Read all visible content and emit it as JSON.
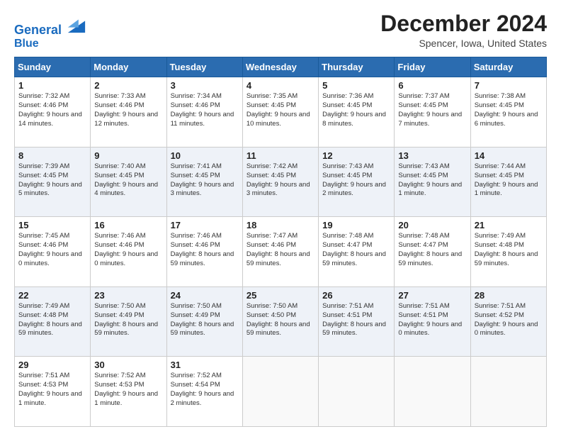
{
  "header": {
    "logo_line1": "General",
    "logo_line2": "Blue",
    "title": "December 2024",
    "subtitle": "Spencer, Iowa, United States"
  },
  "days_of_week": [
    "Sunday",
    "Monday",
    "Tuesday",
    "Wednesday",
    "Thursday",
    "Friday",
    "Saturday"
  ],
  "weeks": [
    [
      {
        "day": "1",
        "sunrise": "7:32 AM",
        "sunset": "4:46 PM",
        "daylight": "9 hours and 14 minutes."
      },
      {
        "day": "2",
        "sunrise": "7:33 AM",
        "sunset": "4:46 PM",
        "daylight": "9 hours and 12 minutes."
      },
      {
        "day": "3",
        "sunrise": "7:34 AM",
        "sunset": "4:46 PM",
        "daylight": "9 hours and 11 minutes."
      },
      {
        "day": "4",
        "sunrise": "7:35 AM",
        "sunset": "4:45 PM",
        "daylight": "9 hours and 10 minutes."
      },
      {
        "day": "5",
        "sunrise": "7:36 AM",
        "sunset": "4:45 PM",
        "daylight": "9 hours and 8 minutes."
      },
      {
        "day": "6",
        "sunrise": "7:37 AM",
        "sunset": "4:45 PM",
        "daylight": "9 hours and 7 minutes."
      },
      {
        "day": "7",
        "sunrise": "7:38 AM",
        "sunset": "4:45 PM",
        "daylight": "9 hours and 6 minutes."
      }
    ],
    [
      {
        "day": "8",
        "sunrise": "7:39 AM",
        "sunset": "4:45 PM",
        "daylight": "9 hours and 5 minutes."
      },
      {
        "day": "9",
        "sunrise": "7:40 AM",
        "sunset": "4:45 PM",
        "daylight": "9 hours and 4 minutes."
      },
      {
        "day": "10",
        "sunrise": "7:41 AM",
        "sunset": "4:45 PM",
        "daylight": "9 hours and 3 minutes."
      },
      {
        "day": "11",
        "sunrise": "7:42 AM",
        "sunset": "4:45 PM",
        "daylight": "9 hours and 3 minutes."
      },
      {
        "day": "12",
        "sunrise": "7:43 AM",
        "sunset": "4:45 PM",
        "daylight": "9 hours and 2 minutes."
      },
      {
        "day": "13",
        "sunrise": "7:43 AM",
        "sunset": "4:45 PM",
        "daylight": "9 hours and 1 minute."
      },
      {
        "day": "14",
        "sunrise": "7:44 AM",
        "sunset": "4:45 PM",
        "daylight": "9 hours and 1 minute."
      }
    ],
    [
      {
        "day": "15",
        "sunrise": "7:45 AM",
        "sunset": "4:46 PM",
        "daylight": "9 hours and 0 minutes."
      },
      {
        "day": "16",
        "sunrise": "7:46 AM",
        "sunset": "4:46 PM",
        "daylight": "9 hours and 0 minutes."
      },
      {
        "day": "17",
        "sunrise": "7:46 AM",
        "sunset": "4:46 PM",
        "daylight": "8 hours and 59 minutes."
      },
      {
        "day": "18",
        "sunrise": "7:47 AM",
        "sunset": "4:46 PM",
        "daylight": "8 hours and 59 minutes."
      },
      {
        "day": "19",
        "sunrise": "7:48 AM",
        "sunset": "4:47 PM",
        "daylight": "8 hours and 59 minutes."
      },
      {
        "day": "20",
        "sunrise": "7:48 AM",
        "sunset": "4:47 PM",
        "daylight": "8 hours and 59 minutes."
      },
      {
        "day": "21",
        "sunrise": "7:49 AM",
        "sunset": "4:48 PM",
        "daylight": "8 hours and 59 minutes."
      }
    ],
    [
      {
        "day": "22",
        "sunrise": "7:49 AM",
        "sunset": "4:48 PM",
        "daylight": "8 hours and 59 minutes."
      },
      {
        "day": "23",
        "sunrise": "7:50 AM",
        "sunset": "4:49 PM",
        "daylight": "8 hours and 59 minutes."
      },
      {
        "day": "24",
        "sunrise": "7:50 AM",
        "sunset": "4:49 PM",
        "daylight": "8 hours and 59 minutes."
      },
      {
        "day": "25",
        "sunrise": "7:50 AM",
        "sunset": "4:50 PM",
        "daylight": "8 hours and 59 minutes."
      },
      {
        "day": "26",
        "sunrise": "7:51 AM",
        "sunset": "4:51 PM",
        "daylight": "8 hours and 59 minutes."
      },
      {
        "day": "27",
        "sunrise": "7:51 AM",
        "sunset": "4:51 PM",
        "daylight": "9 hours and 0 minutes."
      },
      {
        "day": "28",
        "sunrise": "7:51 AM",
        "sunset": "4:52 PM",
        "daylight": "9 hours and 0 minutes."
      }
    ],
    [
      {
        "day": "29",
        "sunrise": "7:51 AM",
        "sunset": "4:53 PM",
        "daylight": "9 hours and 1 minute."
      },
      {
        "day": "30",
        "sunrise": "7:52 AM",
        "sunset": "4:53 PM",
        "daylight": "9 hours and 1 minute."
      },
      {
        "day": "31",
        "sunrise": "7:52 AM",
        "sunset": "4:54 PM",
        "daylight": "9 hours and 2 minutes."
      },
      null,
      null,
      null,
      null
    ]
  ]
}
